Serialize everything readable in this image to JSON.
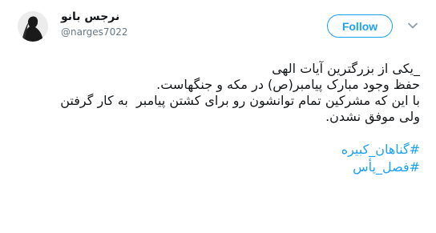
{
  "author": {
    "display_name": "نرجس بانو",
    "handle": "@narges7022",
    "avatar_icon": "avatar-silhouette"
  },
  "actions": {
    "follow_label": "Follow",
    "menu_icon": "chevron-down-icon"
  },
  "tweet": {
    "lines": [
      "_یکی از بزرگترین آیات الهی",
      "حفظ وجود مبارک پیامبر(ص) در مکه و جنگهاست.",
      "با این که مشرکین تمام توانشون رو برای کشتن پیامبر  به کار گرفتن",
      "ولی موفق نشدن."
    ],
    "hashtags": [
      "#گناهان_کبیره",
      "#فصل_یأس"
    ]
  },
  "colors": {
    "accent": "#1da1f2",
    "text": "#14171a",
    "muted": "#657786"
  }
}
